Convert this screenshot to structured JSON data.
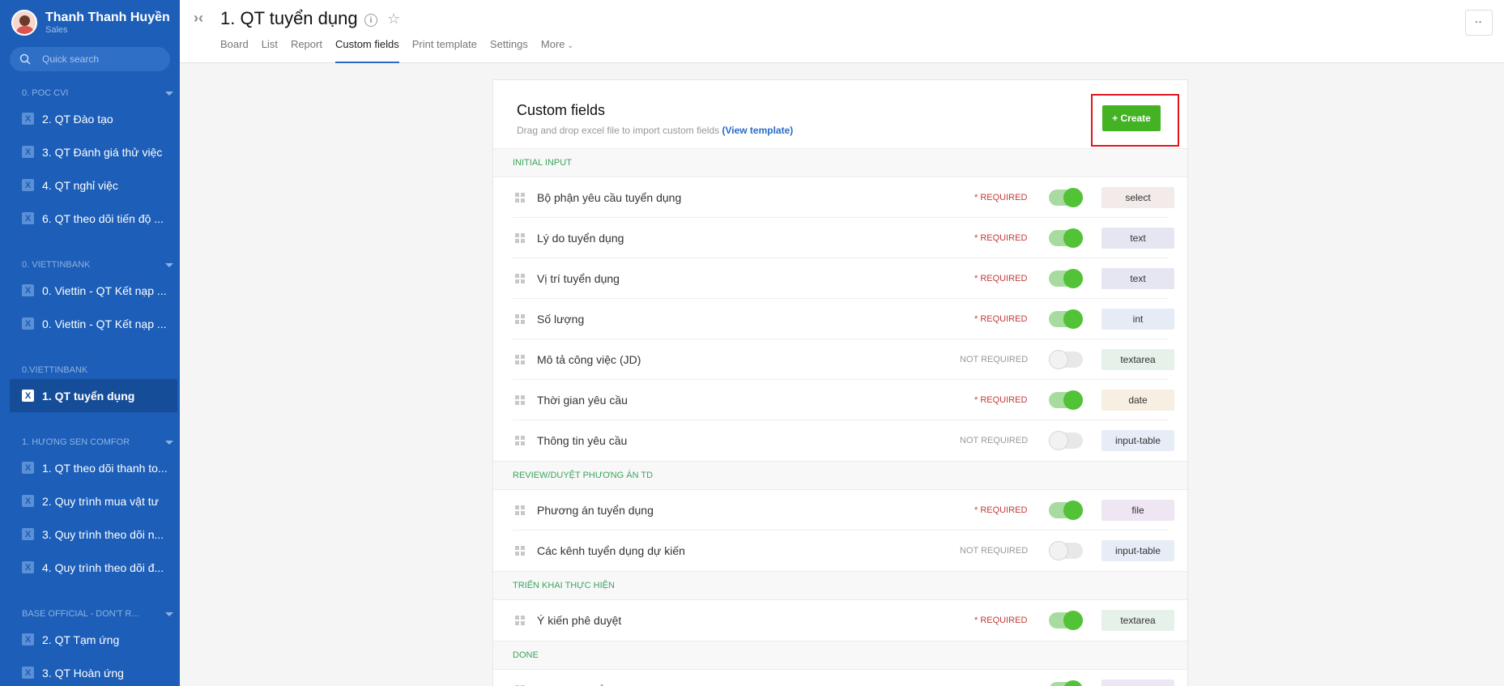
{
  "sidebar": {
    "user_name": "Thanh Thanh Huyền",
    "user_role": "Sales",
    "search_placeholder": "Quick search",
    "groups": [
      {
        "title": "0. POC CVI",
        "items": [
          "2. QT Đào tạo",
          "3. QT Đánh giá thử việc",
          "4. QT nghỉ việc",
          "6. QT theo dõi tiến độ ..."
        ]
      },
      {
        "title": "0. VIETTINBANK",
        "items": [
          "0. Viettin - QT Kết nạp ...",
          "0. Viettin - QT Kết nạp ..."
        ]
      },
      {
        "title": "0.VIETTINBANK",
        "items": [
          "1. QT tuyển dụng"
        ]
      },
      {
        "title": "1. HƯƠNG SEN COMFOR",
        "items": [
          "1. QT theo dõi thanh to...",
          "2. Quy trình mua vật tư",
          "3. Quy trình theo dõi n...",
          "4. Quy trình theo dõi đ..."
        ]
      },
      {
        "title": "BASE OFFICIAL - DON'T R...",
        "items": [
          "2. QT Tạm ứng",
          "3. QT Hoàn ứng"
        ]
      }
    ]
  },
  "header": {
    "title": "1. QT tuyển dụng",
    "tabs": [
      "Board",
      "List",
      "Report",
      "Custom fields",
      "Print template",
      "Settings",
      "More"
    ],
    "more_button": "··"
  },
  "panel": {
    "title": "Custom fields",
    "subtitle": "Drag and drop excel file to import custom fields",
    "template_link": "(View template)",
    "create_label": "+ Create",
    "sections": [
      {
        "title": "INITIAL INPUT",
        "fields": [
          {
            "name": "Bộ phận yêu cầu tuyển dụng",
            "requirement": "* REQUIRED",
            "enabled": true,
            "type": "select",
            "type_color": "#f3eaea"
          },
          {
            "name": "Lý do tuyển dụng",
            "requirement": "* REQUIRED",
            "enabled": true,
            "type": "text",
            "type_color": "#e6e6f3"
          },
          {
            "name": "Vị trí tuyển dụng",
            "requirement": "* REQUIRED",
            "enabled": true,
            "type": "text",
            "type_color": "#e6e6f3"
          },
          {
            "name": "Số lượng",
            "requirement": "* REQUIRED",
            "enabled": true,
            "type": "int",
            "type_color": "#e6ecf6"
          },
          {
            "name": "Mô tả công việc (JD)",
            "requirement": "NOT REQUIRED",
            "enabled": false,
            "type": "textarea",
            "type_color": "#e6f1ea"
          },
          {
            "name": "Thời gian yêu cầu",
            "requirement": "* REQUIRED",
            "enabled": true,
            "type": "date",
            "type_color": "#f6efe2"
          },
          {
            "name": "Thông tin yêu cầu",
            "requirement": "NOT REQUIRED",
            "enabled": false,
            "type": "input-table",
            "type_color": "#e6edf6"
          }
        ]
      },
      {
        "title": "REVIEW/DUYỆT PHƯƠNG ÁN TD",
        "fields": [
          {
            "name": "Phương án tuyển dụng",
            "requirement": "* REQUIRED",
            "enabled": true,
            "type": "file",
            "type_color": "#efe6f3"
          },
          {
            "name": "Các kênh tuyển dụng dự kiến",
            "requirement": "NOT REQUIRED",
            "enabled": false,
            "type": "input-table",
            "type_color": "#e6edf6"
          }
        ]
      },
      {
        "title": "TRIỂN KHAI THỰC HIỆN",
        "fields": [
          {
            "name": "Ý kiến phê duyệt",
            "requirement": "* REQUIRED",
            "enabled": true,
            "type": "textarea",
            "type_color": "#e6f1ea"
          }
        ]
      },
      {
        "title": "DONE",
        "fields": [
          {
            "name": "Báo cáo tuyển dụng",
            "requirement": "* REQUIRED",
            "enabled": true,
            "type": "file",
            "type_color": "#efe6f3"
          }
        ]
      }
    ]
  }
}
